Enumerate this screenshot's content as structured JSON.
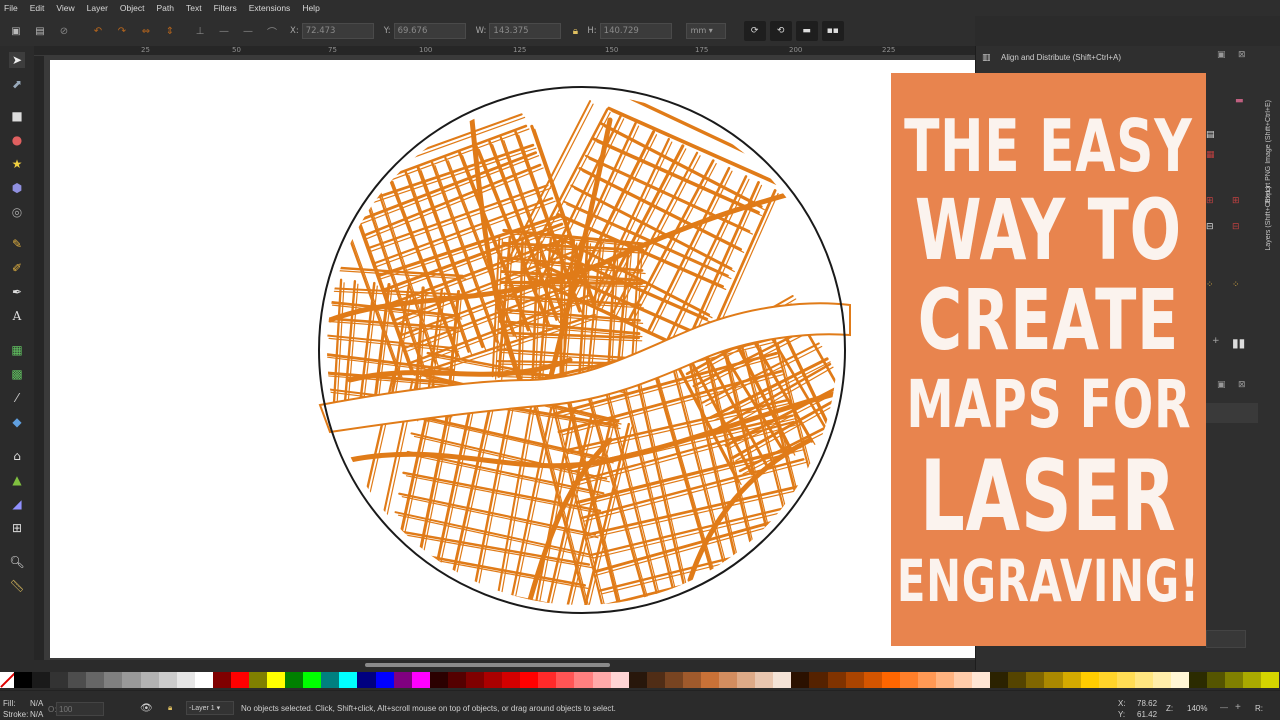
{
  "menu": [
    "File",
    "Edit",
    "View",
    "Layer",
    "Object",
    "Path",
    "Text",
    "Filters",
    "Extensions",
    "Help"
  ],
  "controls": {
    "x_label": "X:",
    "x_value": "72.473",
    "y_label": "Y:",
    "y_value": "69.676",
    "w_label": "W:",
    "w_value": "143.375",
    "h_label": "H:",
    "h_value": "140.729",
    "units": "mm"
  },
  "ruler_labels": [
    "25",
    "50",
    "75",
    "100",
    "125",
    "150",
    "175",
    "200",
    "225"
  ],
  "dock": {
    "panel_title": "Align and Distribute (Shift+Ctrl+A)",
    "vertical_tab_export": "Export PNG Image (Shift+Ctrl+E)",
    "vertical_tab_layers": "Layers (Shift+Ctrl+L)"
  },
  "banner": {
    "lines": [
      "THE EASY",
      "WAY TO",
      "CREATE",
      "MAPS FOR",
      "LASER",
      "ENGRAVING!"
    ],
    "background": "#e8844e",
    "text_color": "#fbf3ee"
  },
  "artwork": {
    "description_color_roads": "#e07b18",
    "circle_color": "#1a1a1a"
  },
  "palette": [
    "#000000",
    "#1a1a1a",
    "#333333",
    "#4d4d4d",
    "#666666",
    "#808080",
    "#999999",
    "#b3b3b3",
    "#cccccc",
    "#e6e6e6",
    "#ffffff",
    "#800000",
    "#ff0000",
    "#808000",
    "#ffff00",
    "#008000",
    "#00ff00",
    "#008080",
    "#00ffff",
    "#000080",
    "#0000ff",
    "#800080",
    "#ff00ff",
    "#2b0000",
    "#550000",
    "#800000",
    "#aa0000",
    "#d40000",
    "#ff0000",
    "#ff2a2a",
    "#ff5555",
    "#ff8080",
    "#ffaaaa",
    "#ffd5d5",
    "#28170b",
    "#502d16",
    "#784421",
    "#a05a2c",
    "#c87137",
    "#d38d5f",
    "#deaa87",
    "#e9c6af",
    "#f4e3d7",
    "#2b1100",
    "#552200",
    "#803300",
    "#aa4400",
    "#d45500",
    "#ff6600",
    "#ff7f2a",
    "#ff9955",
    "#ffb380",
    "#ffccaa",
    "#ffe6d5",
    "#2b2200",
    "#554400",
    "#806600",
    "#aa8800",
    "#d4aa00",
    "#ffcc00",
    "#ffd42a",
    "#ffdd55",
    "#ffe680",
    "#ffeeaa",
    "#fff6d5",
    "#2b2b00",
    "#555500",
    "#808000",
    "#aaaa00",
    "#d4d400"
  ],
  "status": {
    "fill_label": "Fill:",
    "fill_value": "N/A",
    "stroke_label": "Stroke:",
    "stroke_value": "N/A",
    "opacity_label": "O:",
    "opacity_value": "100",
    "layer": "-Layer 1",
    "message": "No objects selected. Click, Shift+click, Alt+scroll mouse on top of objects, or drag around objects to select.",
    "x_label": "X:",
    "x_value": "78.62",
    "y_label": "Y:",
    "y_value": "61.42",
    "z_label": "Z:",
    "zoom": "140%",
    "r_label": "R:"
  }
}
